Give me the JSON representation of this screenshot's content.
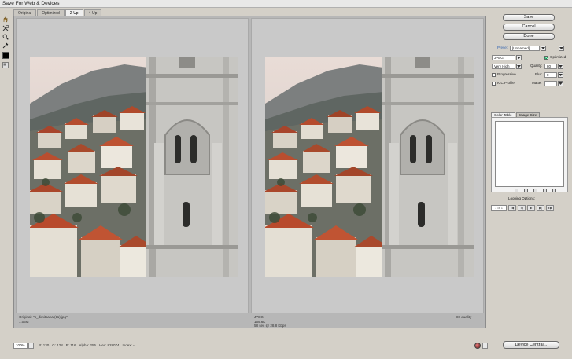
{
  "window": {
    "title": "Save For Web & Devices"
  },
  "tabs": [
    "Original",
    "Optimized",
    "2-Up",
    "4-Up"
  ],
  "panes": {
    "left": {
      "line1": "Original: \"5_dimitsana (11).jpg\"",
      "line2": "1.03M"
    },
    "right": {
      "line1": "JPEG",
      "line2": "159.6K",
      "line3": "58 sec @ 28.8 Kbps",
      "quality_note": "80 quality"
    }
  },
  "buttons": {
    "save": "Save",
    "cancel": "Cancel",
    "done": "Done",
    "device_central": "Device Central..."
  },
  "settings": {
    "preset_label": "Preset:",
    "preset_value": "[Unnamed]",
    "format": "JPEG",
    "quality_level": "Very High",
    "optimized_label": "Optimized",
    "quality_label": "Quality:",
    "quality_value": "80",
    "blur_label": "Blur:",
    "blur_value": "0",
    "progressive_label": "Progressive",
    "icc_label": "ICC Profile",
    "matte_label": "Matte:"
  },
  "color_table": {
    "tabs": [
      "Color Table",
      "Image Size"
    ],
    "looping_label": "Looping Options:",
    "frame_count": "1 of 1"
  },
  "status_bar": {
    "zoom": "100%",
    "readout": [
      "R: 130",
      "G: 128",
      "B: 116",
      "Alpha: 255",
      "Hex: 828074",
      "Index: --"
    ]
  },
  "colors": {
    "accent": "#2b5fb0",
    "photo_roof": "#b84a2c",
    "photo_stone": "#c9c8c4"
  }
}
